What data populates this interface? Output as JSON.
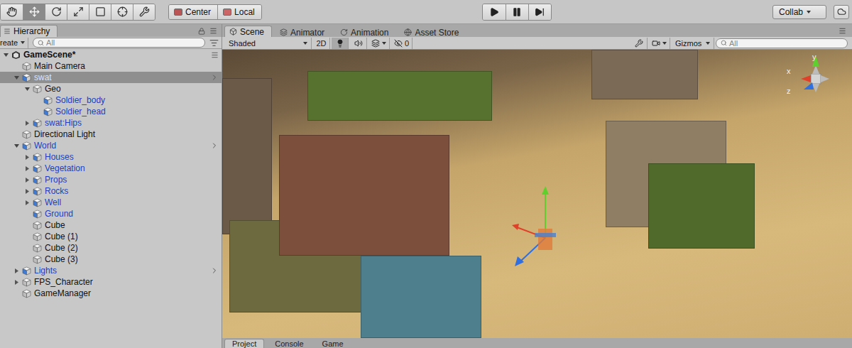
{
  "toolbar": {
    "tools": [
      {
        "kind": "hand",
        "selected": false
      },
      {
        "kind": "move",
        "selected": true
      },
      {
        "kind": "rotate",
        "selected": false
      },
      {
        "kind": "scale",
        "selected": false
      },
      {
        "kind": "rect",
        "selected": false
      },
      {
        "kind": "transform",
        "selected": false
      },
      {
        "kind": "custom",
        "selected": false
      }
    ],
    "pivot": [
      {
        "label": "Center",
        "kind": "center"
      },
      {
        "label": "Local",
        "kind": "local"
      }
    ],
    "playback": [
      {
        "kind": "play",
        "on": false
      },
      {
        "kind": "pause",
        "on": false
      },
      {
        "kind": "step",
        "on": false
      }
    ],
    "collab": {
      "label": "Collab"
    }
  },
  "hierarchy": {
    "title": "Hierarchy",
    "create": "reate",
    "search": {
      "placeholder": "All"
    },
    "rows": [
      {
        "label": "GameScene*",
        "kind": "scene",
        "depth": 0,
        "expandable": true,
        "expanded": true,
        "prefab": false,
        "selected": false,
        "arrow": false
      },
      {
        "label": "Main Camera",
        "kind": "object",
        "depth": 1,
        "expandable": false,
        "expanded": false,
        "prefab": false,
        "selected": false,
        "arrow": false
      },
      {
        "label": "swat",
        "kind": "object",
        "depth": 1,
        "expandable": true,
        "expanded": true,
        "prefab": true,
        "selected": true,
        "arrow": true
      },
      {
        "label": "Geo",
        "kind": "object",
        "depth": 2,
        "expandable": true,
        "expanded": true,
        "prefab": false,
        "selected": false,
        "arrow": false
      },
      {
        "label": "Soldier_body",
        "kind": "object",
        "depth": 3,
        "expandable": false,
        "expanded": false,
        "prefab": true,
        "selected": false,
        "arrow": false
      },
      {
        "label": "Soldier_head",
        "kind": "object",
        "depth": 3,
        "expandable": false,
        "expanded": false,
        "prefab": true,
        "selected": false,
        "arrow": false
      },
      {
        "label": "swat:Hips",
        "kind": "object",
        "depth": 2,
        "expandable": true,
        "expanded": false,
        "prefab": true,
        "selected": false,
        "arrow": false
      },
      {
        "label": "Directional Light",
        "kind": "object",
        "depth": 1,
        "expandable": false,
        "expanded": false,
        "prefab": false,
        "selected": false,
        "arrow": false
      },
      {
        "label": "World",
        "kind": "object",
        "depth": 1,
        "expandable": true,
        "expanded": true,
        "prefab": true,
        "selected": false,
        "arrow": true
      },
      {
        "label": "Houses",
        "kind": "object",
        "depth": 2,
        "expandable": true,
        "expanded": false,
        "prefab": true,
        "selected": false,
        "arrow": false
      },
      {
        "label": "Vegetation",
        "kind": "object",
        "depth": 2,
        "expandable": true,
        "expanded": false,
        "prefab": true,
        "selected": false,
        "arrow": false
      },
      {
        "label": "Props",
        "kind": "object",
        "depth": 2,
        "expandable": true,
        "expanded": false,
        "prefab": true,
        "selected": false,
        "arrow": false
      },
      {
        "label": "Rocks",
        "kind": "object",
        "depth": 2,
        "expandable": true,
        "expanded": false,
        "prefab": true,
        "selected": false,
        "arrow": false
      },
      {
        "label": "Well",
        "kind": "object",
        "depth": 2,
        "expandable": true,
        "expanded": false,
        "prefab": true,
        "selected": false,
        "arrow": false
      },
      {
        "label": "Ground",
        "kind": "object",
        "depth": 2,
        "expandable": false,
        "expanded": false,
        "prefab": true,
        "selected": false,
        "arrow": false
      },
      {
        "label": "Cube",
        "kind": "object",
        "depth": 2,
        "expandable": false,
        "expanded": false,
        "prefab": false,
        "selected": false,
        "arrow": false
      },
      {
        "label": "Cube (1)",
        "kind": "object",
        "depth": 2,
        "expandable": false,
        "expanded": false,
        "prefab": false,
        "selected": false,
        "arrow": false
      },
      {
        "label": "Cube (2)",
        "kind": "object",
        "depth": 2,
        "expandable": false,
        "expanded": false,
        "prefab": false,
        "selected": false,
        "arrow": false
      },
      {
        "label": "Cube (3)",
        "kind": "object",
        "depth": 2,
        "expandable": false,
        "expanded": false,
        "prefab": false,
        "selected": false,
        "arrow": false
      },
      {
        "label": "Lights",
        "kind": "object",
        "depth": 1,
        "expandable": true,
        "expanded": false,
        "prefab": true,
        "selected": false,
        "arrow": true
      },
      {
        "label": "FPS_Character",
        "kind": "object",
        "depth": 1,
        "expandable": true,
        "expanded": false,
        "prefab": false,
        "selected": false,
        "arrow": false
      },
      {
        "label": "GameManager",
        "kind": "object",
        "depth": 1,
        "expandable": false,
        "expanded": false,
        "prefab": false,
        "selected": false,
        "arrow": false
      }
    ]
  },
  "scene": {
    "tabs": [
      {
        "label": "Scene",
        "kind": "scene",
        "selected": true
      },
      {
        "label": "Animator",
        "kind": "animator",
        "selected": false
      },
      {
        "label": "Animation",
        "kind": "animation",
        "selected": false
      },
      {
        "label": "Asset Store",
        "kind": "store",
        "selected": false
      }
    ],
    "toolbar": {
      "shading": "Shaded",
      "mode_2d": {
        "label": "2D",
        "on": false
      },
      "lighting_on": true,
      "audio_on": false,
      "hidden_count": "0",
      "gizmos": "Gizmos",
      "search": {
        "placeholder": "All"
      }
    },
    "axes": [
      {
        "label": "y",
        "color": "#5fcf2e"
      },
      {
        "label": "x",
        "color": "#e0402a"
      },
      {
        "label": "z",
        "color": "#2f6fe0"
      }
    ]
  },
  "bottom_tabs": [
    {
      "label": "Project",
      "selected": true
    },
    {
      "label": "Console",
      "selected": false
    },
    {
      "label": "Game",
      "selected": false
    }
  ]
}
